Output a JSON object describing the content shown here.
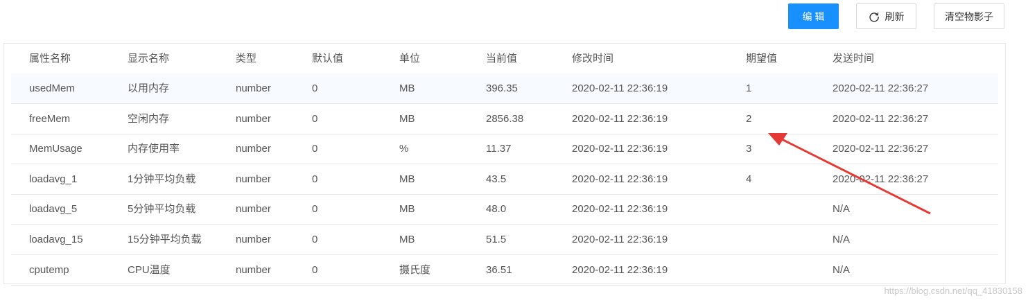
{
  "toolbar": {
    "edit_label": "编 辑",
    "refresh_label": "刷新",
    "clear_shadow_label": "清空物影子",
    "primary_color": "#1890ff"
  },
  "table": {
    "headers": [
      "属性名称",
      "显示名称",
      "类型",
      "默认值",
      "单位",
      "当前值",
      "修改时间",
      "期望值",
      "发送时间"
    ],
    "rows": [
      [
        "usedMem",
        "以用内存",
        "number",
        "0",
        "MB",
        "396.35",
        "2020-02-11 22:36:19",
        "1",
        "2020-02-11 22:36:27"
      ],
      [
        "freeMem",
        "空闲内存",
        "number",
        "0",
        "MB",
        "2856.38",
        "2020-02-11 22:36:19",
        "2",
        "2020-02-11 22:36:27"
      ],
      [
        "MemUsage",
        "内存使用率",
        "number",
        "0",
        "%",
        "11.37",
        "2020-02-11 22:36:19",
        "3",
        "2020-02-11 22:36:27"
      ],
      [
        "loadavg_1",
        "1分钟平均负载",
        "number",
        "0",
        "MB",
        "43.5",
        "2020-02-11 22:36:19",
        "4",
        "2020-02-11 22:36:27"
      ],
      [
        "loadavg_5",
        "5分钟平均负载",
        "number",
        "0",
        "MB",
        "48.0",
        "2020-02-11 22:36:19",
        "",
        "N/A"
      ],
      [
        "loadavg_15",
        "15分钟平均负载",
        "number",
        "0",
        "MB",
        "51.5",
        "2020-02-11 22:36:19",
        "",
        "N/A"
      ],
      [
        "cputemp",
        "CPU温度",
        "number",
        "0",
        "摄氏度",
        "36.51",
        "2020-02-11 22:36:19",
        "",
        "N/A"
      ]
    ]
  },
  "annotation": {
    "arrow_color": "#e53935"
  },
  "watermark": "https://blog.csdn.net/qq_41830158"
}
